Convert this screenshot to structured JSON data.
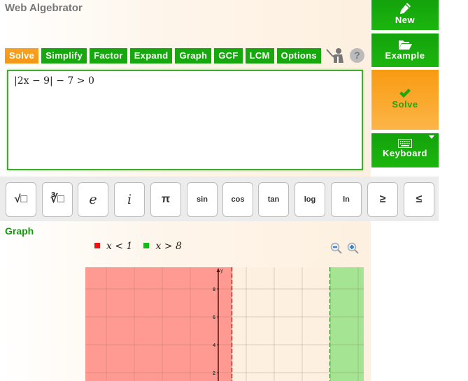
{
  "app": {
    "title": "Web Algebrator"
  },
  "toolbar": {
    "tabs": [
      {
        "label": "Solve",
        "active": true
      },
      {
        "label": "Simplify",
        "active": false
      },
      {
        "label": "Factor",
        "active": false
      },
      {
        "label": "Expand",
        "active": false
      },
      {
        "label": "Graph",
        "active": false
      },
      {
        "label": "GCF",
        "active": false
      },
      {
        "label": "LCM",
        "active": false
      },
      {
        "label": "Options",
        "active": false
      }
    ],
    "help_label": "?"
  },
  "editor": {
    "expression": "|2x − 9| − 7 > 0"
  },
  "side_buttons": {
    "new": {
      "label": "New",
      "icon": "pencil-icon"
    },
    "example": {
      "label": "Example",
      "icon": "folder-open-icon"
    },
    "solve": {
      "label": "Solve",
      "icon": "checkmark-icon"
    },
    "keyboard": {
      "label": "Keyboard",
      "icon": "keyboard-icon"
    }
  },
  "keypad": {
    "keys": [
      {
        "label": "√□",
        "name": "sqrt"
      },
      {
        "label": "∛□",
        "name": "cbrt"
      },
      {
        "label": "e",
        "name": "e"
      },
      {
        "label": "i",
        "name": "i"
      },
      {
        "label": "π",
        "name": "pi"
      },
      {
        "label": "sin",
        "name": "sin"
      },
      {
        "label": "cos",
        "name": "cos"
      },
      {
        "label": "tan",
        "name": "tan"
      },
      {
        "label": "log",
        "name": "log"
      },
      {
        "label": "ln",
        "name": "ln"
      },
      {
        "label": "≥",
        "name": "geq"
      },
      {
        "label": "≤",
        "name": "leq"
      }
    ]
  },
  "graph": {
    "title": "Graph",
    "legend": [
      {
        "label": "x < 1",
        "color": "#ee1111"
      },
      {
        "label": "x > 8",
        "color": "#11bb11"
      }
    ]
  },
  "chart_data": {
    "type": "area",
    "title": "Graph",
    "xlabel": "",
    "ylabel": "y",
    "xlim": [
      -9.5,
      10.4
    ],
    "ylim": [
      -1,
      9.5
    ],
    "grid": true,
    "x_gridlines": [
      -8,
      -6,
      -4,
      -2,
      2,
      4,
      6,
      8,
      10
    ],
    "y_ticks": [
      2,
      4,
      6,
      8
    ],
    "regions": [
      {
        "name": "x < 1",
        "from": -9.5,
        "to": 1,
        "boundary": 1,
        "boundary_style": "dashed",
        "fill": "#ff9a92",
        "line": "#ee1111"
      },
      {
        "name": "x > 8",
        "from": 8,
        "to": 10.4,
        "boundary": 8,
        "boundary_style": "dashed",
        "fill": "#a4e492",
        "line": "#11bb11"
      }
    ],
    "legend_position": "top"
  }
}
